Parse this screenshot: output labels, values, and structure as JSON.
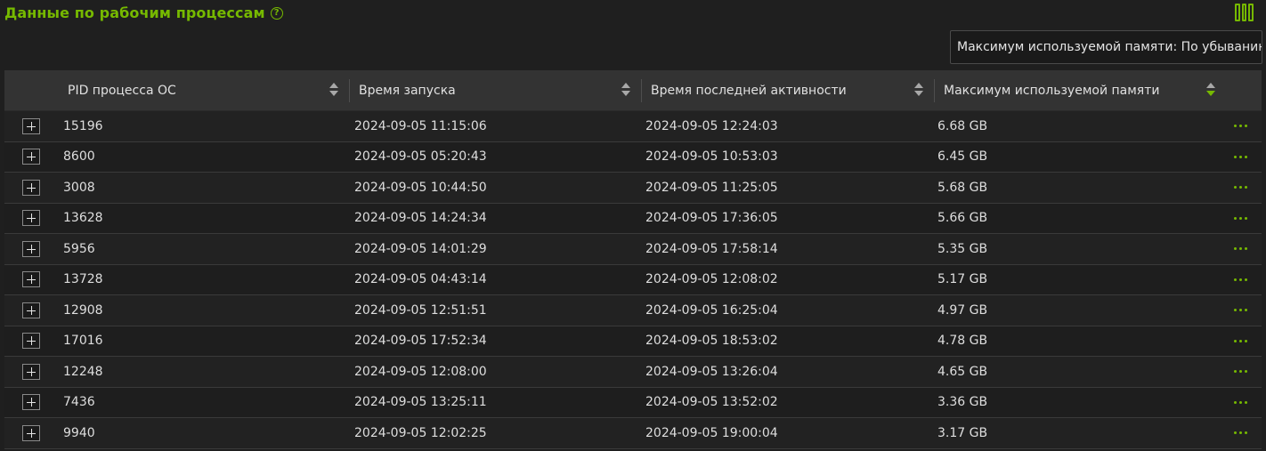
{
  "header": {
    "title": "Данные по рабочим процессам",
    "help_icon": "?",
    "accent_color": "#76b900"
  },
  "sort_indicator": "Максимум используемой памяти: По убыванию",
  "table": {
    "columns": [
      "PID процесса ОС",
      "Время запуска",
      "Время последней активности",
      "Максимум используемой памяти"
    ],
    "active_sort_column": 3,
    "rows": [
      {
        "pid": "15196",
        "start": "2024-09-05 11:15:06",
        "last": "2024-09-05 12:24:03",
        "mem": "6.68 GB"
      },
      {
        "pid": "8600",
        "start": "2024-09-05 05:20:43",
        "last": "2024-09-05 10:53:03",
        "mem": "6.45 GB"
      },
      {
        "pid": "3008",
        "start": "2024-09-05 10:44:50",
        "last": "2024-09-05 11:25:05",
        "mem": "5.68 GB"
      },
      {
        "pid": "13628",
        "start": "2024-09-05 14:24:34",
        "last": "2024-09-05 17:36:05",
        "mem": "5.66 GB"
      },
      {
        "pid": "5956",
        "start": "2024-09-05 14:01:29",
        "last": "2024-09-05 17:58:14",
        "mem": "5.35 GB"
      },
      {
        "pid": "13728",
        "start": "2024-09-05 04:43:14",
        "last": "2024-09-05 12:08:02",
        "mem": "5.17 GB"
      },
      {
        "pid": "12908",
        "start": "2024-09-05 12:51:51",
        "last": "2024-09-05 16:25:04",
        "mem": "4.97 GB"
      },
      {
        "pid": "17016",
        "start": "2024-09-05 17:52:34",
        "last": "2024-09-05 18:53:02",
        "mem": "4.78 GB"
      },
      {
        "pid": "12248",
        "start": "2024-09-05 12:08:00",
        "last": "2024-09-05 13:26:04",
        "mem": "4.65 GB"
      },
      {
        "pid": "7436",
        "start": "2024-09-05 13:25:11",
        "last": "2024-09-05 13:52:02",
        "mem": "3.36 GB"
      },
      {
        "pid": "9940",
        "start": "2024-09-05 12:02:25",
        "last": "2024-09-05 19:00:04",
        "mem": "3.17 GB"
      }
    ]
  }
}
